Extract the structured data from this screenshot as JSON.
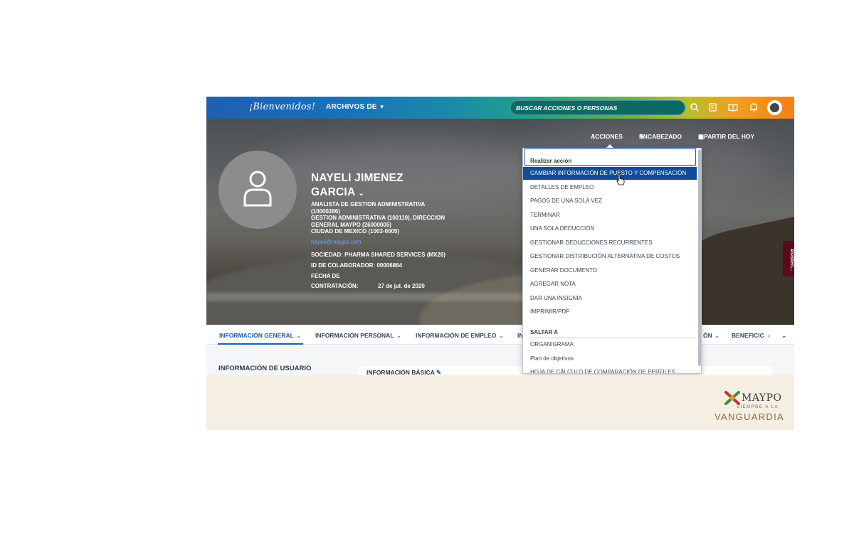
{
  "topbar": {
    "logo": "¡Bienvenidos!",
    "menu_label": "ARCHIVOS DE",
    "search_placeholder": "BUSCAR ACCIONES O PERSONAS"
  },
  "profile": {
    "name_line1": "NAYELI JIMENEZ",
    "name_line2": "GARCIA",
    "job_title": "ANALISTA DE GESTION ADMINISTRATIVA (10000286)",
    "department": "GESTION ADMINISTRATIVA (100110), DIRECCION GENERAL MAYPO (26000005)",
    "location": "CIUDAD DE MEXICO (1003-0005)",
    "email": "nayeli@maypo.com",
    "company": "SOCIEDAD: PHARMA SHARED SERVICES (MX26)",
    "employee_id": "ID DE COLABORADOR: 00006864",
    "hire_label_1": "FECHA DE",
    "hire_label_2": "CONTRATACIÓN:",
    "hire_date": "27 de jul. de 2020"
  },
  "hero_actions": {
    "actions": "ACCIONES",
    "header": "ENCABEZADO",
    "as_of": "A PARTIR DEL HOY"
  },
  "side_tab": "Asisten...",
  "tabs": [
    {
      "label": "INFORMACIÓN GENERAL"
    },
    {
      "label": "INFORMACIÓN PERSONAL"
    },
    {
      "label": "INFORMACIÓN DE EMPLEO"
    },
    {
      "label": "IN"
    },
    {
      "label": "ÓN"
    },
    {
      "label": "BENEFICIC"
    }
  ],
  "content": {
    "user_info_title": "INFORMACIÓN DE USUARIO",
    "basic_info_title": "INFORMACIÓN BÁSICA"
  },
  "dropdown": {
    "header": "Realizar acción",
    "items": [
      "CAMBIAR INFORMACIÓN DE PUESTO Y COMPENSACIÓN",
      "DETALLES DE EMPLEO",
      "PAGOS DE UNA SOLA VEZ",
      "TERMINAR",
      "UNA SOLA DEDUCCIÓN",
      "GESTIONAR DEDUCCIONES RECURRENTES",
      "GESTIONAR DISTRIBUCIÓN ALTERNATIVA DE COSTOS",
      "GENERAR DOCUMENTO",
      "AGREGAR NOTA",
      "DAR UNA INSIGNIA",
      "IMPRIMIR/PDF"
    ],
    "jump_header": "SALTAR A",
    "jump_items": [
      "ORGANIGRAMA",
      "Plan de objetivos",
      "HOJA DE CÁLCULO DE COMPARACIÓN DE PERFILES"
    ]
  },
  "footer": {
    "brand": "MAYPO",
    "tagline": "SIEMPRE A LA",
    "slogan": "VANGUARDIA"
  },
  "colors": {
    "accent": "#1a5fb4",
    "selected": "#0f4c9a",
    "footer_bg": "#f5efe3"
  }
}
